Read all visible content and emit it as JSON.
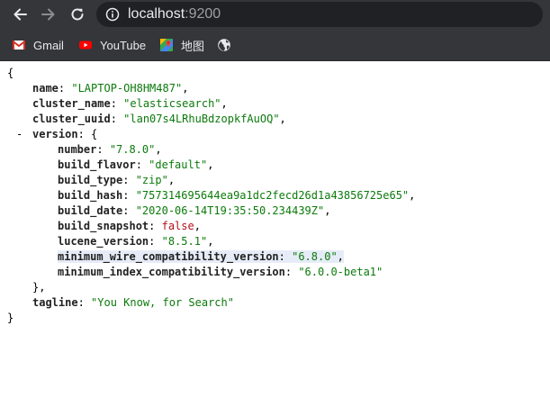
{
  "browser": {
    "url_host": "localhost",
    "url_port": ":9200",
    "bookmarks": [
      {
        "label": "Gmail",
        "icon": "gmail-icon"
      },
      {
        "label": "YouTube",
        "icon": "youtube-icon"
      },
      {
        "label": "地图",
        "icon": "maps-icon"
      },
      {
        "label": "",
        "icon": "globe-icon"
      }
    ]
  },
  "json_view": {
    "open_brace": "{",
    "close_brace": "}",
    "collapse_toggle": "-",
    "name_key": "name",
    "name_value": "\"LAPTOP-OH8HM487\"",
    "cluster_name_key": "cluster_name",
    "cluster_name_value": "\"elasticsearch\"",
    "cluster_uuid_key": "cluster_uuid",
    "cluster_uuid_value": "\"lan07s4LRhuBdzopkfAuOQ\"",
    "version_key": "version",
    "version_open": "{",
    "version_close": "},",
    "number_key": "number",
    "number_value": "\"7.8.0\"",
    "build_flavor_key": "build_flavor",
    "build_flavor_value": "\"default\"",
    "build_type_key": "build_type",
    "build_type_value": "\"zip\"",
    "build_hash_key": "build_hash",
    "build_hash_value": "\"757314695644ea9a1dc2fecd26d1a43856725e65\"",
    "build_date_key": "build_date",
    "build_date_value": "\"2020-06-14T19:35:50.234439Z\"",
    "build_snapshot_key": "build_snapshot",
    "build_snapshot_value": "false",
    "lucene_version_key": "lucene_version",
    "lucene_version_value": "\"8.5.1\"",
    "min_wire_key": "minimum_wire_compatibility_version",
    "min_wire_value": "\"6.8.0\"",
    "min_index_key": "minimum_index_compatibility_version",
    "min_index_value": "\"6.0.0-beta1\"",
    "tagline_key": "tagline",
    "tagline_value": "\"You Know, for Search\"",
    "colon": ": ",
    "comma": ","
  },
  "colors": {
    "toolbar": "#35363a",
    "omnibox": "#202124",
    "string": "#0b7a0b",
    "boolean": "#b4101a"
  }
}
